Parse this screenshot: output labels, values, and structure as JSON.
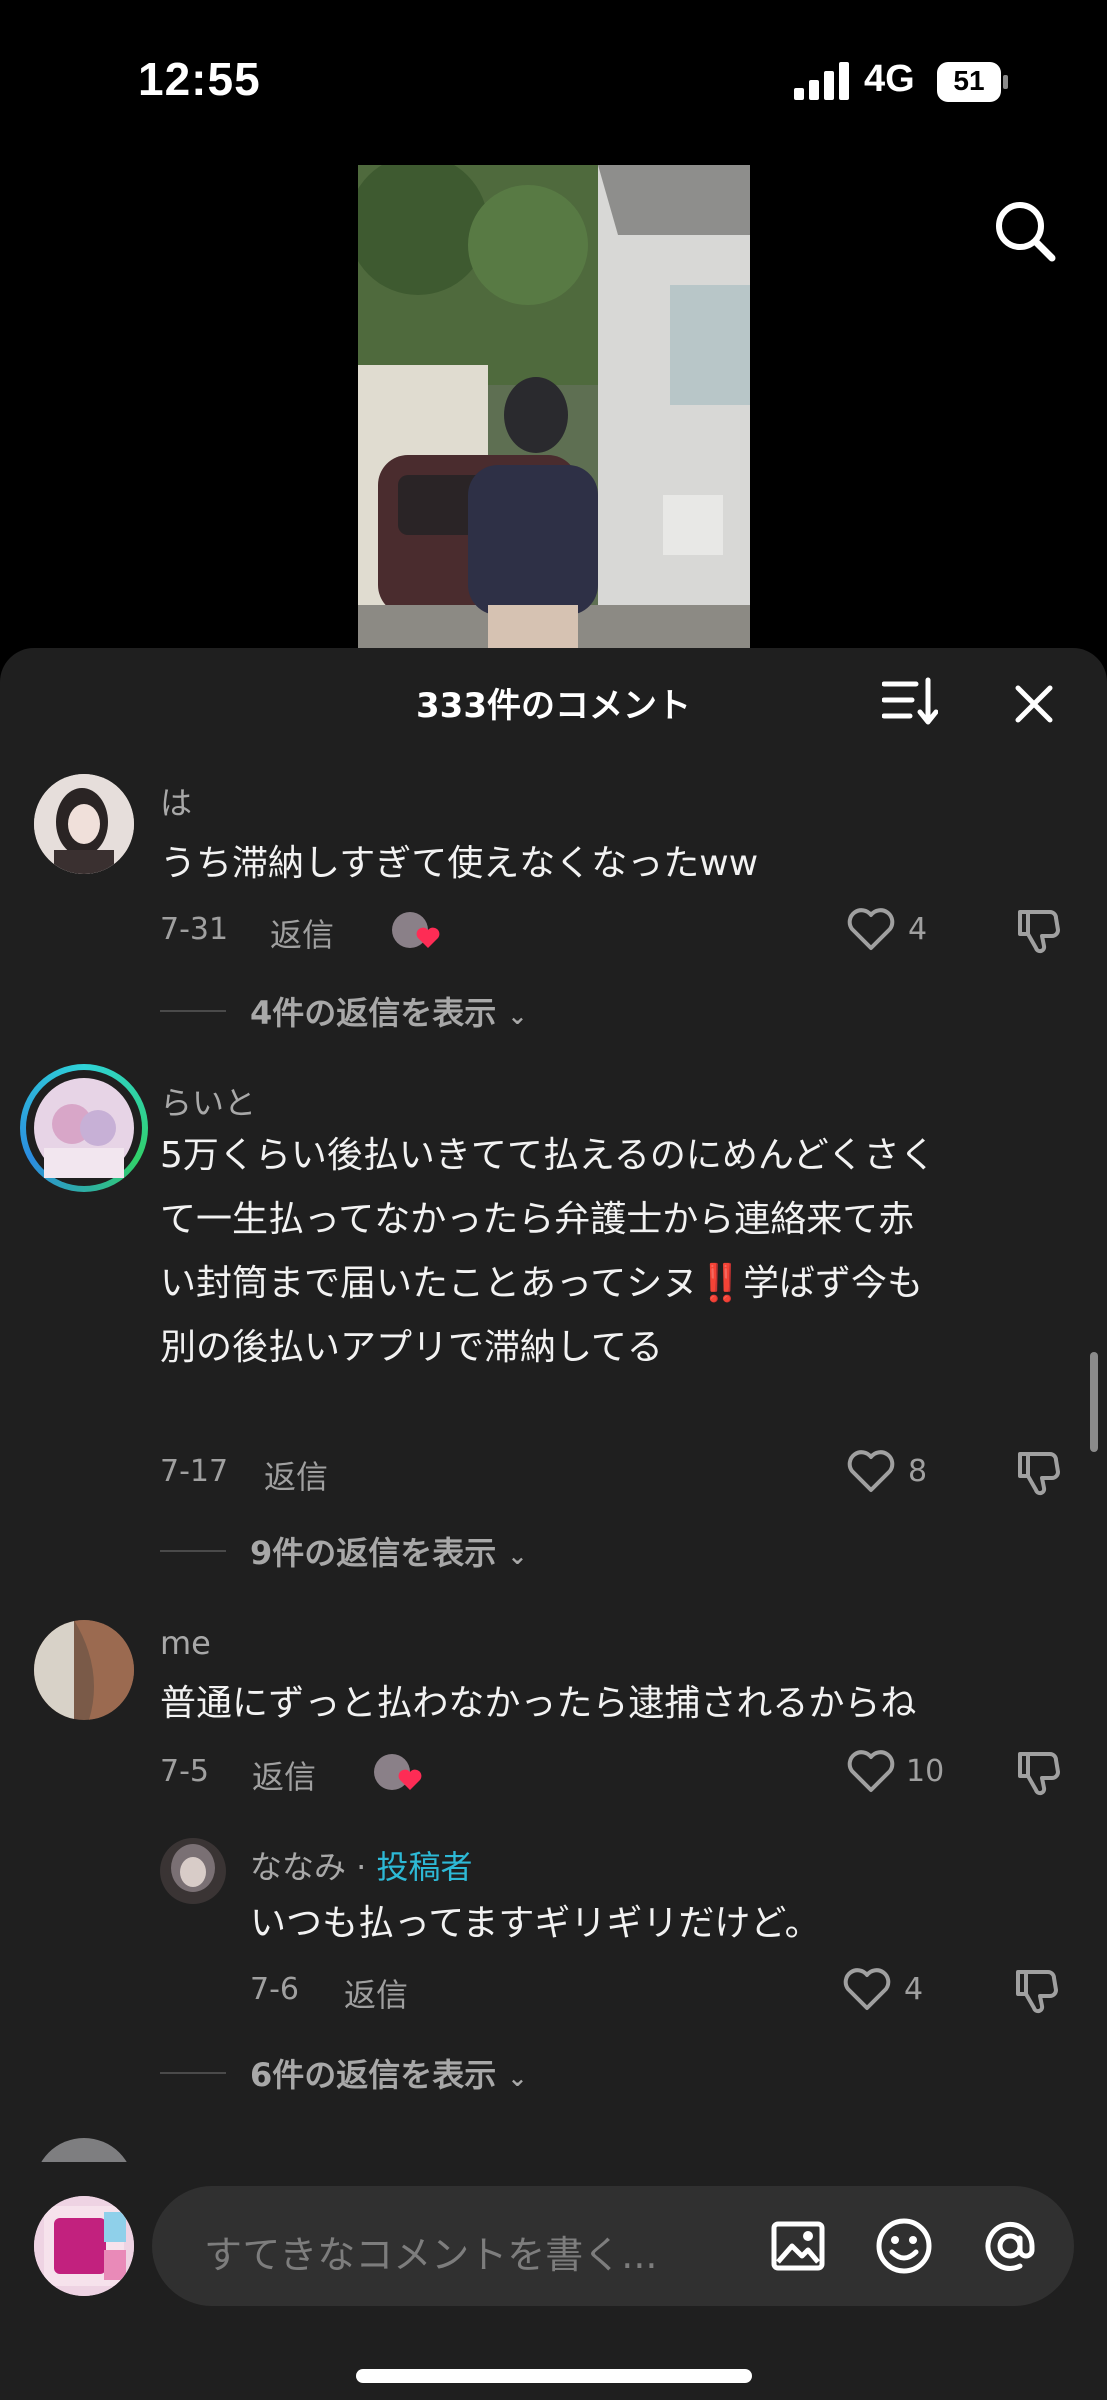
{
  "status": {
    "time": "12:55",
    "network": "4G",
    "battery": "51"
  },
  "comments_header": {
    "title": "333件のコメント"
  },
  "comments": [
    {
      "user": "は",
      "text": "うち滞納しすぎて使えなくなったww",
      "date": "7-31",
      "reply": "返信",
      "likes": "4",
      "more": "4件の返信を表示"
    },
    {
      "user": "らいと",
      "text_lines": [
        "5万くらい後払いきてて払えるのにめんどくさく",
        "て一生払ってなかったら弁護士から連絡来て赤",
        "い封筒まで届いたことあってシヌ",
        "学ばず今も",
        "別の後払いアプリで滞納してる"
      ],
      "emoji": "‼️",
      "date": "7-17",
      "reply": "返信",
      "likes": "8",
      "more": "9件の返信を表示"
    },
    {
      "user": "me",
      "text": "普通にずっと払わなかったら逮捕されるからね",
      "date": "7-5",
      "reply": "返信",
      "likes": "10",
      "sub_reply": {
        "user": "ななみ · ",
        "tag": "投稿者",
        "text": "いつも払ってますギリギリだけど。",
        "date": "7-6",
        "reply": "返信",
        "likes": "4"
      },
      "more": "6件の返信を表示"
    }
  ],
  "input": {
    "placeholder": "すてきなコメントを書く..."
  },
  "colors": {
    "accent": "#2db9d6",
    "like_heart": "#fe2c55",
    "sheet_bg": "#1f1f1f"
  }
}
